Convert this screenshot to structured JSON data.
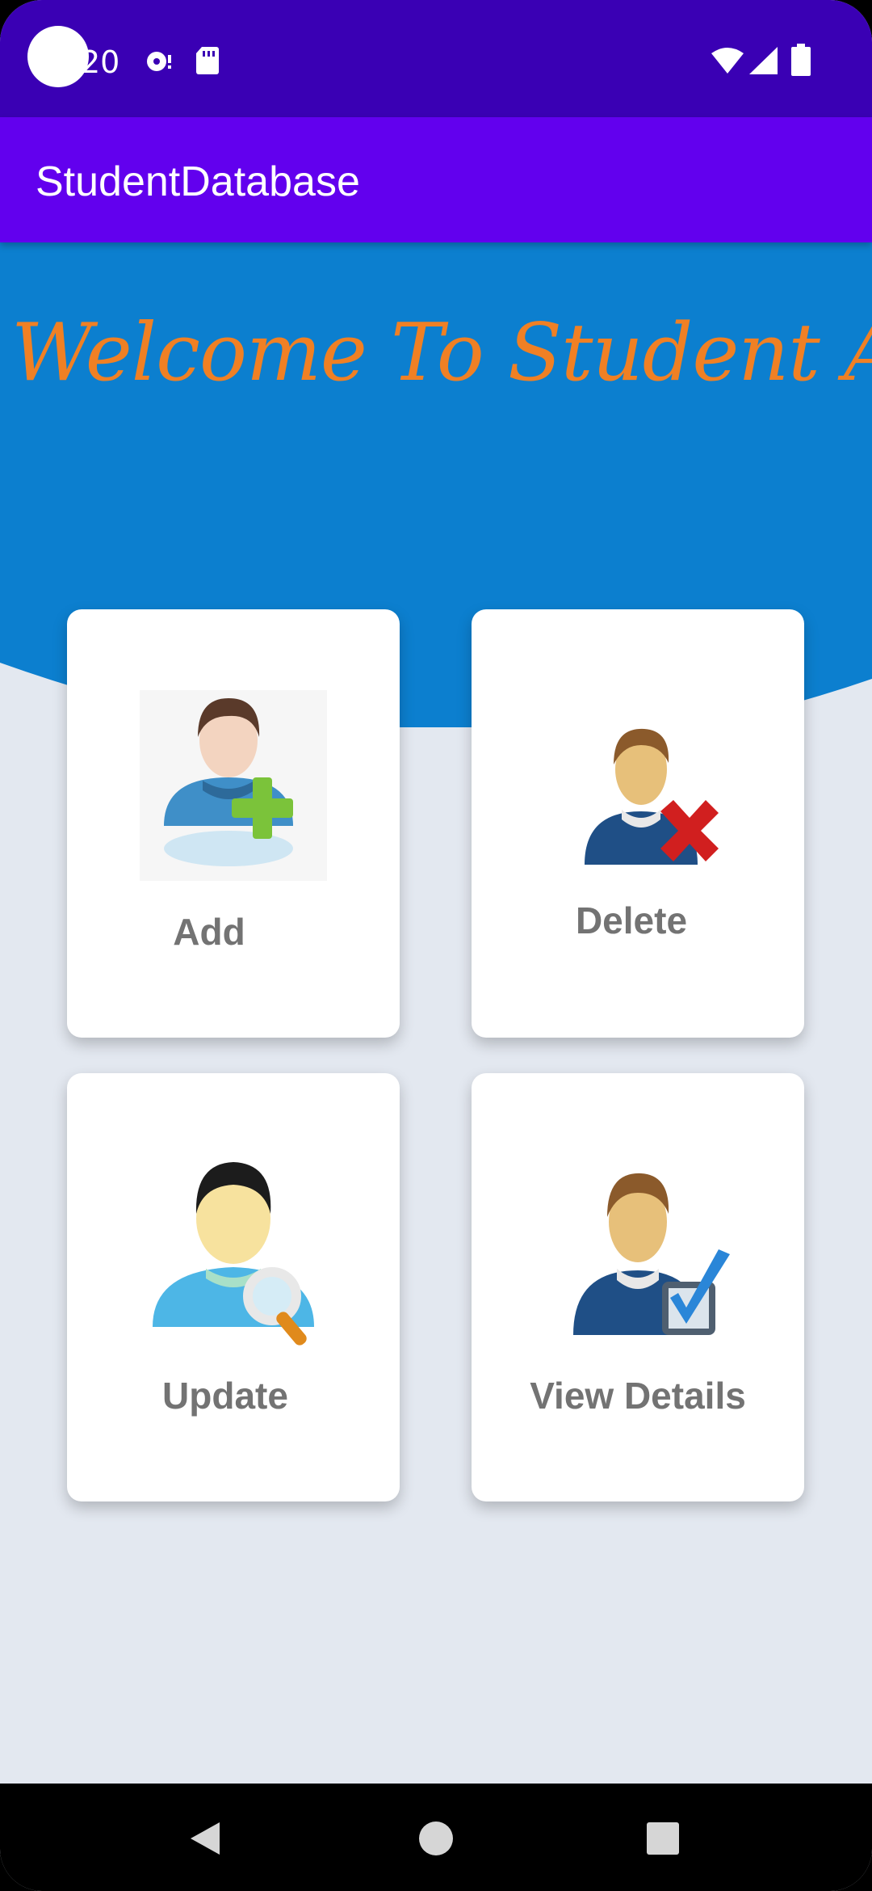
{
  "status_bar": {
    "time": "20",
    "icons": [
      "media-icon",
      "sd-card-icon",
      "wifi-icon",
      "signal-icon",
      "battery-icon"
    ]
  },
  "app_bar": {
    "title": "StudentDatabase"
  },
  "header": {
    "welcome": "Welcome To Student App :"
  },
  "cards": {
    "add": {
      "label": "Add",
      "icon": "add-student-icon"
    },
    "delete": {
      "label": "Delete",
      "icon": "delete-student-icon"
    },
    "update": {
      "label": "Update",
      "icon": "search-student-icon"
    },
    "view": {
      "label": "View Details",
      "icon": "view-details-icon"
    }
  },
  "nav_bar": {
    "buttons": [
      "back-icon",
      "home-icon",
      "recents-icon"
    ]
  },
  "colors": {
    "status_bar": "#3a00b4",
    "app_bar": "#6200ee",
    "header_blue": "#0c7fcf",
    "welcome_text": "#f08024",
    "background": "#e3e8f0",
    "card_label": "#737373"
  }
}
